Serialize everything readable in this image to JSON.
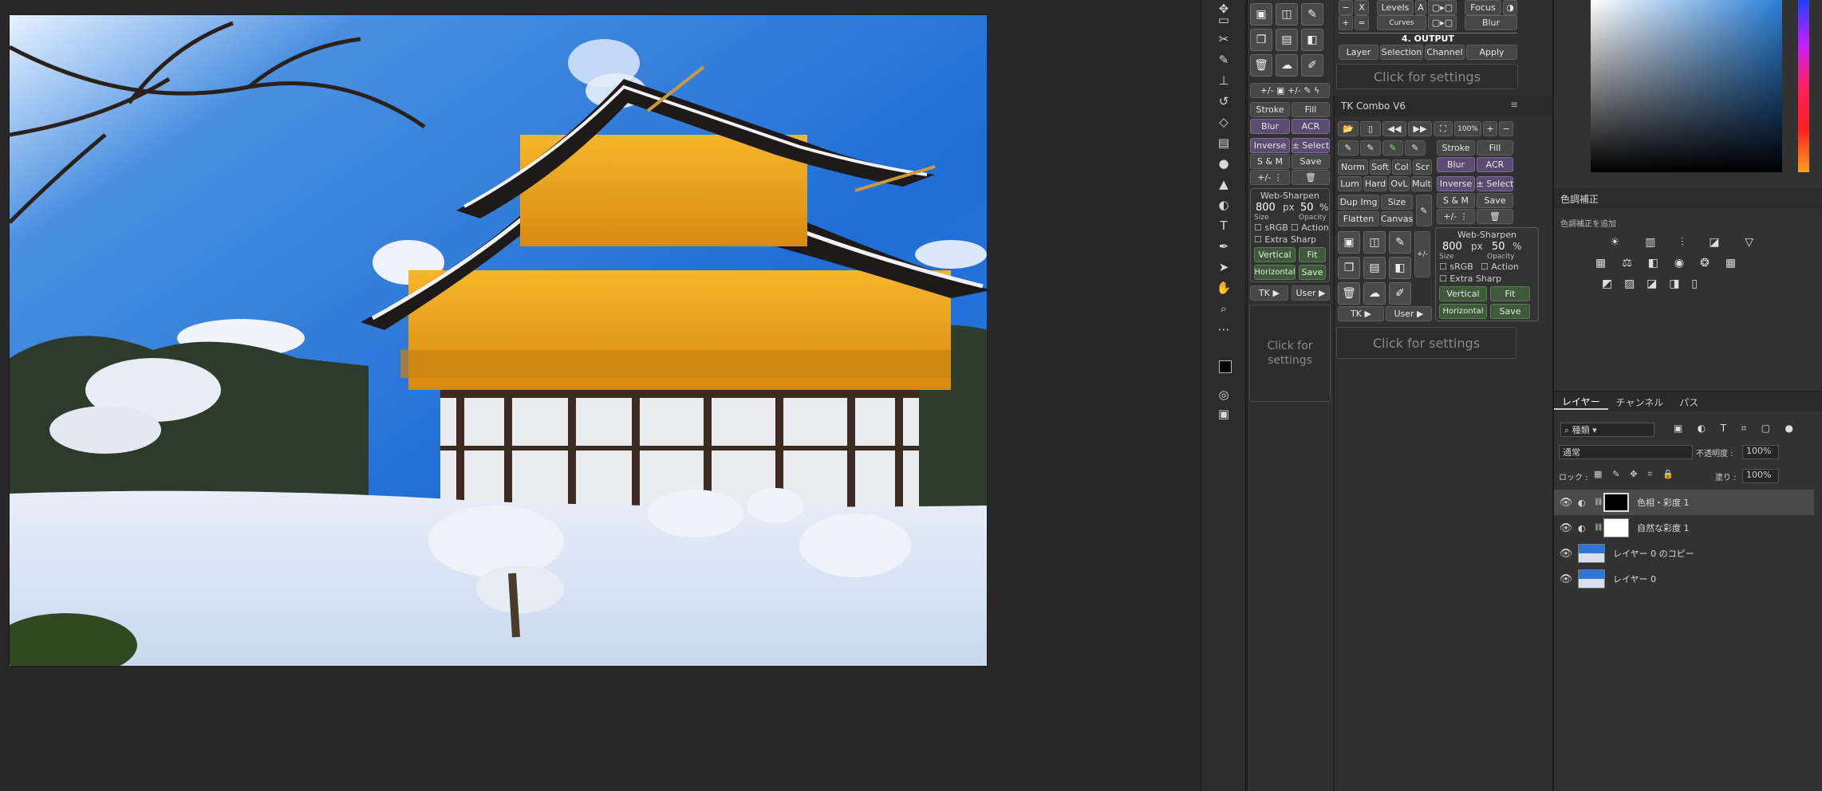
{
  "toolbar": {
    "icons": [
      "move-icon",
      "marquee-icon",
      "lasso-icon",
      "crop-icon",
      "brush-icon",
      "stamp-icon",
      "history-brush-icon",
      "eraser-icon",
      "gradient-icon",
      "blur-icon",
      "sharpen-icon",
      "dodge-icon",
      "text-icon",
      "pen-icon",
      "path-select-icon",
      "hand-icon",
      "zoom-icon",
      "more-icon",
      "swap-colors-icon",
      "quick-mask-icon",
      "screen-mode-icon"
    ]
  },
  "tk_left": {
    "top_row": {
      "minus": "−",
      "x": "X",
      "levels": "Levels",
      "a": "A",
      "focus": "Focus",
      "plus": "+",
      "eq": "=",
      "curves": "Curves",
      "blur": "Blur"
    },
    "output_title": "4. OUTPUT",
    "output_buttons": [
      "Layer",
      "Selection",
      "Channel",
      "Apply"
    ],
    "click_settings": "Click for settings",
    "stroke": "Stroke",
    "fill": "Fill",
    "blur": "Blur",
    "acr": "ACR",
    "inverse": "Inverse",
    "select": "± Select",
    "sm": "S & M",
    "save": "Save",
    "websharpen": {
      "title": "Web-Sharpen",
      "size": "800",
      "px": "px",
      "opacity": "50",
      "pct": "%",
      "size_label": "Size",
      "opacity_label": "Opacity",
      "srgb": "sRGB",
      "action": "Action",
      "extra": "Extra Sharp",
      "vertical": "Vertical",
      "fit": "Fit",
      "horizontal": "Horizontal",
      "save": "Save"
    },
    "tk": "TK ▶",
    "user": "User ▶"
  },
  "tk_mid": {
    "click_settings": "Click for\nsettings"
  },
  "tk_combo": {
    "title": "TK Combo V6",
    "zoom": "100%",
    "stroke": "Stroke",
    "fill": "Fill",
    "blur": "Blur",
    "acr": "ACR",
    "modes": [
      "Norm",
      "Soft",
      "Col",
      "Scr",
      "Lum",
      "Hard",
      "OvL",
      "Mult"
    ],
    "inverse": "Inverse",
    "select": "± Select",
    "sm": "S & M",
    "save": "Save",
    "dupimg": "Dup Img",
    "size": "Size",
    "flatten": "Flatten",
    "canvas": "Canvas",
    "websharpen": {
      "title": "Web-Sharpen",
      "size": "800",
      "px": "px",
      "opacity": "50",
      "pct": "%",
      "size_label": "Size",
      "opacity_label": "Opacity",
      "srgb": "sRGB",
      "action": "Action",
      "extra": "Extra Sharp",
      "vertical": "Vertical",
      "fit": "Fit",
      "horizontal": "Horizontal",
      "save": "Save"
    },
    "tk": "TK ▶",
    "user": "User ▶",
    "click_settings": "Click for settings"
  },
  "adjustments": {
    "tab": "色調補正",
    "add": "色調補正を追加"
  },
  "layers_panel": {
    "tabs": [
      "レイヤー",
      "チャンネル",
      "パス"
    ],
    "filter": "種類",
    "blend": "通常",
    "opacity_label": "不透明度 :",
    "opacity": "100%",
    "lock_label": "ロック :",
    "fill_label": "塗り :",
    "fill": "100%",
    "layers": [
      {
        "name": "色相・彩度 1",
        "thumb": "black",
        "selected": true
      },
      {
        "name": "自然な彩度 1",
        "thumb": "white",
        "selected": false
      },
      {
        "name": "レイヤー 0 のコピー",
        "thumb": "photo",
        "selected": false
      },
      {
        "name": "レイヤー 0",
        "thumb": "photo",
        "selected": false
      }
    ]
  }
}
